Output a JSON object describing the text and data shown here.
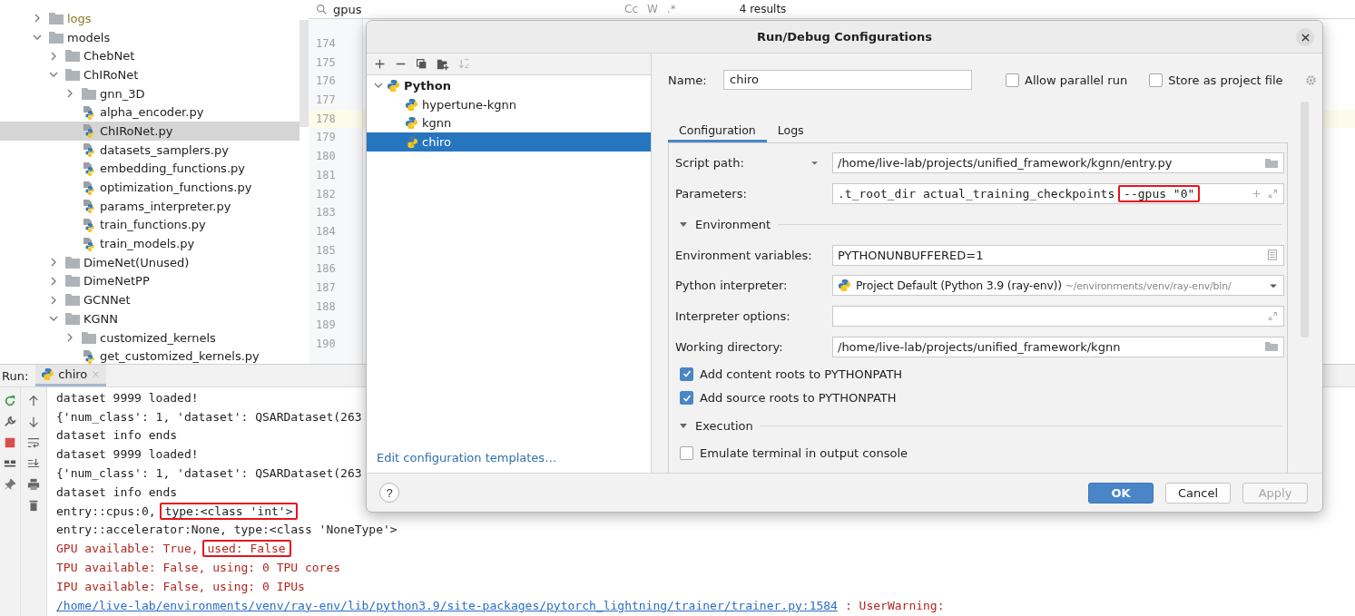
{
  "editor_search": {
    "query": "gpus",
    "options": [
      "Cc",
      "W",
      ".*"
    ],
    "results": "4 results"
  },
  "project_tree": [
    {
      "label": "logs",
      "kind": "folder",
      "expanded": false,
      "excluded": true,
      "selected": false
    },
    {
      "label": "models",
      "kind": "folder",
      "expanded": true,
      "excluded": false,
      "selected": false,
      "children": [
        {
          "label": "ChebNet",
          "kind": "folder",
          "expanded": false,
          "excluded": false,
          "selected": false
        },
        {
          "label": "ChIRoNet",
          "kind": "folder",
          "expanded": true,
          "excluded": false,
          "selected": false,
          "children": [
            {
              "label": "gnn_3D",
              "kind": "folder",
              "expanded": false,
              "excluded": false,
              "selected": false
            },
            {
              "label": "alpha_encoder.py",
              "kind": "file",
              "excluded": false,
              "selected": false
            },
            {
              "label": "ChIRoNet.py",
              "kind": "file",
              "excluded": false,
              "selected": true
            },
            {
              "label": "datasets_samplers.py",
              "kind": "file",
              "excluded": false,
              "selected": false
            },
            {
              "label": "embedding_functions.py",
              "kind": "file",
              "excluded": false,
              "selected": false
            },
            {
              "label": "optimization_functions.py",
              "kind": "file",
              "excluded": false,
              "selected": false
            },
            {
              "label": "params_interpreter.py",
              "kind": "file",
              "excluded": false,
              "selected": false
            },
            {
              "label": "train_functions.py",
              "kind": "file",
              "excluded": false,
              "selected": false
            },
            {
              "label": "train_models.py",
              "kind": "file",
              "excluded": false,
              "selected": false
            }
          ]
        },
        {
          "label": "DimeNet(Unused)",
          "kind": "folder",
          "expanded": false,
          "excluded": false,
          "selected": false
        },
        {
          "label": "DimeNetPP",
          "kind": "folder",
          "expanded": false,
          "excluded": false,
          "selected": false
        },
        {
          "label": "GCNNet",
          "kind": "folder",
          "expanded": false,
          "excluded": false,
          "selected": false
        },
        {
          "label": "KGNN",
          "kind": "folder",
          "expanded": true,
          "excluded": false,
          "selected": false,
          "children": [
            {
              "label": "customized_kernels",
              "kind": "folder",
              "expanded": false,
              "excluded": false,
              "selected": false
            },
            {
              "label": "get_customized_kernels.py",
              "kind": "file",
              "excluded": false,
              "selected": false
            }
          ]
        }
      ]
    }
  ],
  "line_numbers": [
    {
      "number": "174",
      "current": false
    },
    {
      "number": "175",
      "current": false
    },
    {
      "number": "176",
      "current": false
    },
    {
      "number": "177",
      "current": false
    },
    {
      "number": "178",
      "current": true
    },
    {
      "number": "179",
      "current": false
    },
    {
      "number": "180",
      "current": false
    },
    {
      "number": "181",
      "current": false
    },
    {
      "number": "182",
      "current": false
    },
    {
      "number": "183",
      "current": false
    },
    {
      "number": "184",
      "current": false
    },
    {
      "number": "185",
      "current": false
    },
    {
      "number": "186",
      "current": false
    },
    {
      "number": "187",
      "current": false
    },
    {
      "number": "188",
      "current": false
    },
    {
      "number": "189",
      "current": false
    },
    {
      "number": "190",
      "current": false
    }
  ],
  "run_panel": {
    "label": "Run:",
    "tab": "chiro",
    "console": [
      [
        {
          "text": "dataset 9999 loaded!",
          "kind": "out",
          "highlighted": false
        }
      ],
      [
        {
          "text": "{'num_class': 1, 'dataset': QSARDataset(263",
          "kind": "out",
          "highlighted": false
        }
      ],
      [
        {
          "text": "dataset info ends",
          "kind": "out",
          "highlighted": false
        }
      ],
      [
        {
          "text": "dataset 9999 loaded!",
          "kind": "out",
          "highlighted": false
        }
      ],
      [
        {
          "text": "{'num_class': 1, 'dataset': QSARDataset(263",
          "kind": "out",
          "highlighted": false
        }
      ],
      [
        {
          "text": "dataset info ends",
          "kind": "out",
          "highlighted": false
        }
      ],
      [
        {
          "text": "entry::cpus:0,",
          "kind": "out",
          "highlighted": false
        },
        {
          "text": "type:<class 'int'>",
          "kind": "out",
          "highlighted": true
        }
      ],
      [
        {
          "text": "entry::accelerator:None, type:<class 'NoneType'>",
          "kind": "out",
          "highlighted": false
        }
      ],
      [
        {
          "text": "GPU available: True,",
          "kind": "err",
          "highlighted": false
        },
        {
          "text": "used: False",
          "kind": "err",
          "highlighted": true
        }
      ],
      [
        {
          "text": "TPU available: False, using: 0 TPU cores",
          "kind": "err",
          "highlighted": false
        }
      ],
      [
        {
          "text": "IPU available: False, using: 0 IPUs",
          "kind": "err",
          "highlighted": false
        }
      ],
      [
        {
          "text": "/home/live-lab/environments/venv/ray-env/lib/python3.9/site-packages/pytorch_lightning/trainer/trainer.py:1584",
          "kind": "link",
          "highlighted": false
        },
        {
          "text": ": UserWarning:",
          "kind": "err",
          "highlighted": false
        }
      ]
    ]
  },
  "dialog": {
    "title": "Run/Debug Configurations",
    "tree": {
      "label": "Python",
      "expanded": true,
      "children": [
        {
          "label": "hypertune-kgnn",
          "selected": false
        },
        {
          "label": "kgnn",
          "selected": false
        },
        {
          "label": "chiro",
          "selected": true
        }
      ]
    },
    "templates_link": "Edit configuration templates…",
    "help": "?",
    "name_label": "Name:",
    "name_value": "chiro",
    "options": [
      {
        "label": "Allow parallel run",
        "checked": false
      },
      {
        "label": "Store as project file",
        "checked": false
      }
    ],
    "tabs": [
      {
        "label": "Configuration",
        "selected": true
      },
      {
        "label": "Logs",
        "selected": false
      }
    ],
    "form": [
      {
        "kind": "browse-field",
        "label": "Script path:",
        "chooser": true,
        "value": [
          {
            "text": "/home/live-lab/projects/unified_framework/kgnn/entry.py",
            "highlighted": false
          }
        ]
      },
      {
        "kind": "params-field",
        "label": "Parameters:",
        "chooser": false,
        "value": [
          {
            "text": ".t_root_dir actual_training_checkpoints ",
            "highlighted": false
          },
          {
            "text": "--gpus \"0\"",
            "highlighted": true
          }
        ]
      },
      {
        "kind": "section",
        "label": "Environment",
        "expanded": true
      },
      {
        "kind": "env-field",
        "label": "Environment variables:",
        "chooser": false,
        "value": [
          {
            "text": "PYTHONUNBUFFERED=1",
            "highlighted": false
          }
        ]
      },
      {
        "kind": "interpreter-field",
        "label": "Python interpreter:",
        "chooser": false,
        "value": [
          {
            "text": "Project Default (Python 3.9 (ray-env))",
            "highlighted": false
          }
        ],
        "hint": "~/environments/venv/ray-env/bin/"
      },
      {
        "kind": "expand-field",
        "label": "Interpreter options:",
        "chooser": false
      },
      {
        "kind": "browse-field",
        "label": "Working directory:",
        "chooser": false,
        "value": [
          {
            "text": "/home/live-lab/projects/unified_framework/kgnn",
            "highlighted": false
          }
        ]
      },
      {
        "kind": "checkbox",
        "label": "Add content roots to PYTHONPATH",
        "checked": true
      },
      {
        "kind": "checkbox",
        "label": "Add source roots to PYTHONPATH",
        "checked": true
      },
      {
        "kind": "section",
        "label": "Execution",
        "expanded": true
      },
      {
        "kind": "checkbox",
        "label": "Emulate terminal in output console",
        "checked": false
      }
    ],
    "buttons": [
      {
        "label": "OK",
        "kind": "default",
        "disabled": false
      },
      {
        "label": "Cancel",
        "kind": "normal",
        "disabled": false
      },
      {
        "label": "Apply",
        "kind": "normal",
        "disabled": true
      }
    ]
  }
}
